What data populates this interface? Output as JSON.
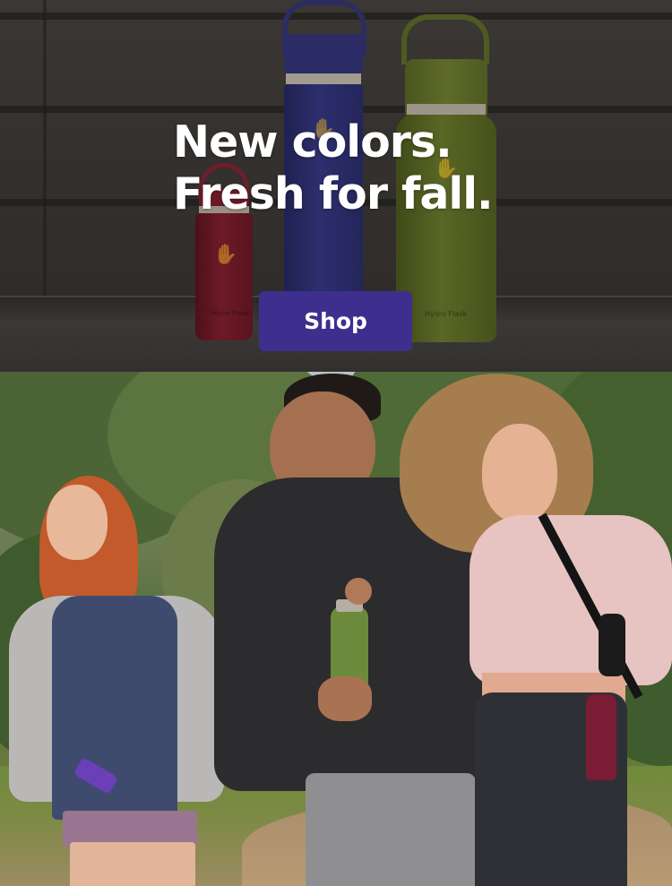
{
  "hero": {
    "title_line1": "New colors.",
    "title_line2": "Fresh for fall.",
    "shop_label": "Shop",
    "colors": {
      "button": "#3e2f8f",
      "title": "#ffffff"
    },
    "bottles": [
      {
        "color": "burgundy",
        "hex": "#6e1a27"
      },
      {
        "color": "navy",
        "hex": "#2d2f6e"
      },
      {
        "color": "olive",
        "hex": "#5a6625"
      }
    ],
    "bottle_brand": "Hydro Flask"
  },
  "lifestyle": {
    "people": [
      "woman-left",
      "man-center",
      "woman-right"
    ]
  }
}
